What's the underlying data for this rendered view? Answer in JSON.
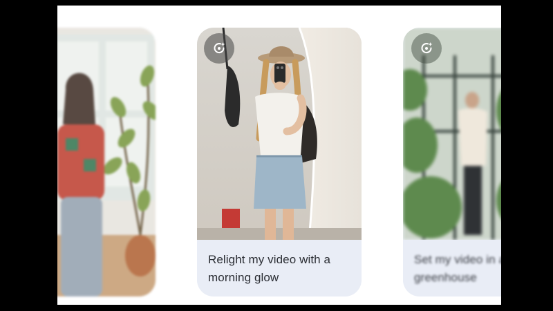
{
  "cards": [
    {
      "id": "living-room",
      "icon": "sparkle-refresh-icon",
      "caption": ""
    },
    {
      "id": "morning-glow",
      "icon": "sparkle-refresh-icon",
      "caption": "Relight my video with a morning glow"
    },
    {
      "id": "greenhouse",
      "icon": "sparkle-refresh-icon",
      "caption": "Set my video in a greenhouse"
    }
  ],
  "colors": {
    "backdrop": "#000000",
    "stage": "#ffffff",
    "caption_panel": "#e9edf6",
    "caption_text": "#2a2d33"
  }
}
